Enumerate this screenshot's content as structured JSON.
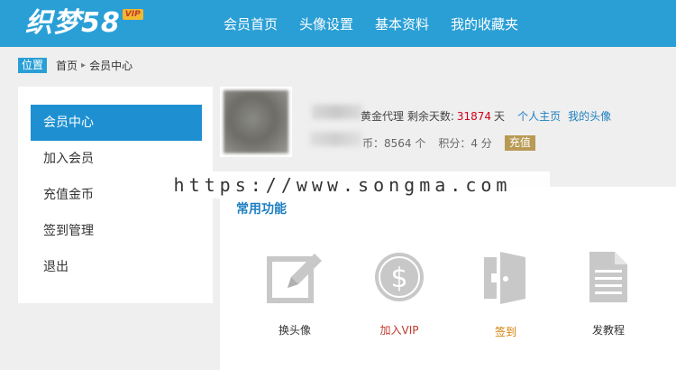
{
  "header": {
    "logo_text": "织梦58",
    "logo_badge": "VIP",
    "nav": [
      "会员首页",
      "头像设置",
      "基本资料",
      "我的收藏夹"
    ]
  },
  "breadcrumb": {
    "badge": "位置",
    "items": [
      "首页",
      "会员中心"
    ],
    "sep": "▸"
  },
  "sidebar": {
    "items": [
      {
        "label": "会员中心",
        "active": true
      },
      {
        "label": "加入会员"
      },
      {
        "label": "充值金币"
      },
      {
        "label": "签到管理"
      },
      {
        "label": "退出"
      }
    ]
  },
  "profile": {
    "level_text": "黄金代理 剩余天数:",
    "days_value": "31874",
    "days_unit": "天",
    "link_home": "个人主页",
    "link_avatar": "我的头像",
    "coins_text": "币：8564 个",
    "points_text": "积分：4 分",
    "recharge_button": "充值"
  },
  "watermark": "https://www.songma.com",
  "panel": {
    "title": "常用功能",
    "functions": [
      {
        "label": "换头像",
        "icon": "edit-icon",
        "color": "#333333"
      },
      {
        "label": "加入VIP",
        "icon": "dollar-coin-icon",
        "color": "#c0392b"
      },
      {
        "label": "签到",
        "icon": "open-door-icon",
        "color": "#d07c00"
      },
      {
        "label": "发教程",
        "icon": "document-icon",
        "color": "#333333"
      }
    ]
  },
  "colors": {
    "header_bg": "#2a9fd6",
    "active_bg": "#1e90d2",
    "accent_link": "#1e7fc1",
    "icon_gray": "#c8c8c8"
  }
}
